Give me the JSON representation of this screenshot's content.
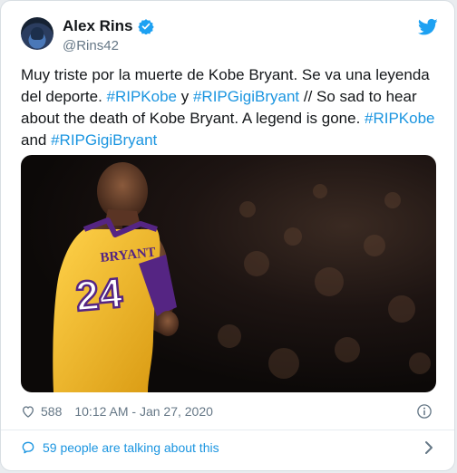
{
  "tweet": {
    "display_name": "Alex Rins",
    "handle": "@Rins42",
    "text_segments": [
      {
        "text": "Muy triste por la muerte de Kobe Bryant. Se va una leyenda del deporte. ",
        "hashtag": false
      },
      {
        "text": "#RIPKobe",
        "hashtag": true
      },
      {
        "text": " y ",
        "hashtag": false
      },
      {
        "text": "#RIPGigiBryant",
        "hashtag": true
      },
      {
        "text": " // So sad to hear about the death of Kobe Bryant. A legend is gone. ",
        "hashtag": false
      },
      {
        "text": "#RIPKobe",
        "hashtag": true
      },
      {
        "text": " and ",
        "hashtag": false
      },
      {
        "text": "#RIPGigiBryant",
        "hashtag": true
      }
    ],
    "media": {
      "jersey_name": "BRYANT",
      "jersey_number": "24"
    },
    "like_count": "588",
    "timestamp": "10:12 AM - Jan 27, 2020",
    "talking": "59 people are talking about this"
  },
  "icons": {
    "verified": "verified-badge-icon",
    "brand": "twitter-bird-icon",
    "like": "heart-icon",
    "info": "info-icon",
    "talk": "speech-bubble-icon",
    "chevron": "chevron-right-icon"
  },
  "colors": {
    "link": "#1b95e0",
    "text": "#14171a",
    "muted": "#657786",
    "jersey": "#f4c02e",
    "trim": "#552583"
  }
}
